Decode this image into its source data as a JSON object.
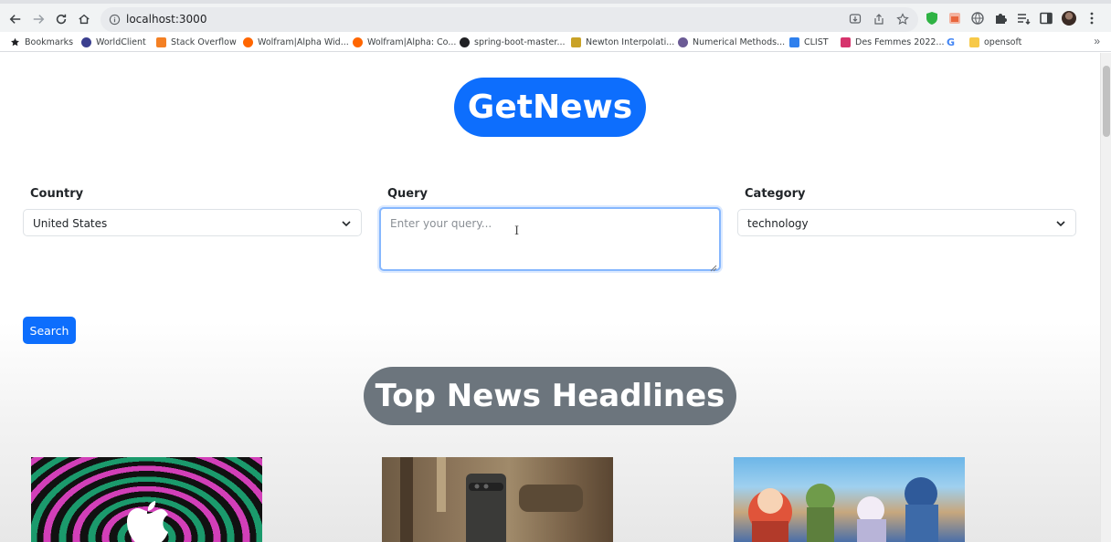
{
  "browser": {
    "url": "localhost:3000",
    "bookmarks": [
      {
        "label": "Bookmarks",
        "icon": "star-icon",
        "color": "#202124"
      },
      {
        "label": "WorldClient",
        "icon": "worldclient-icon",
        "color": "#3b3f8f"
      },
      {
        "label": "Stack Overflow",
        "icon": "stackoverflow-icon",
        "color": "#f48024"
      },
      {
        "label": "Wolfram|Alpha Wid...",
        "icon": "wolfram-icon",
        "color": "#ff6600"
      },
      {
        "label": "Wolfram|Alpha: Co...",
        "icon": "wolfram-icon",
        "color": "#ff6600"
      },
      {
        "label": "spring-boot-master...",
        "icon": "github-icon",
        "color": "#202124"
      },
      {
        "label": "Newton Interpolati...",
        "icon": "page-icon",
        "color": "#c9a227"
      },
      {
        "label": "Numerical Methods...",
        "icon": "gear-icon",
        "color": "#6b5b95"
      },
      {
        "label": "CLIST",
        "icon": "clist-icon",
        "color": "#2f80ed"
      },
      {
        "label": "Des Femmes 2022...",
        "icon": "desfemmes-icon",
        "color": "#d6336c"
      },
      {
        "label": "",
        "icon": "google-icon",
        "color": "#4285f4"
      },
      {
        "label": "opensoft",
        "icon": "folder-icon",
        "color": "#f7c948"
      }
    ]
  },
  "app": {
    "brand": "GetNews",
    "country_label": "Country",
    "country_value": "United States",
    "query_label": "Query",
    "query_placeholder": "Enter your query...",
    "category_label": "Category",
    "category_value": "technology",
    "search_button": "Search",
    "section_title": "Top News Headlines"
  },
  "colors": {
    "primary": "#0d6efd",
    "secondary": "#6c757d"
  }
}
